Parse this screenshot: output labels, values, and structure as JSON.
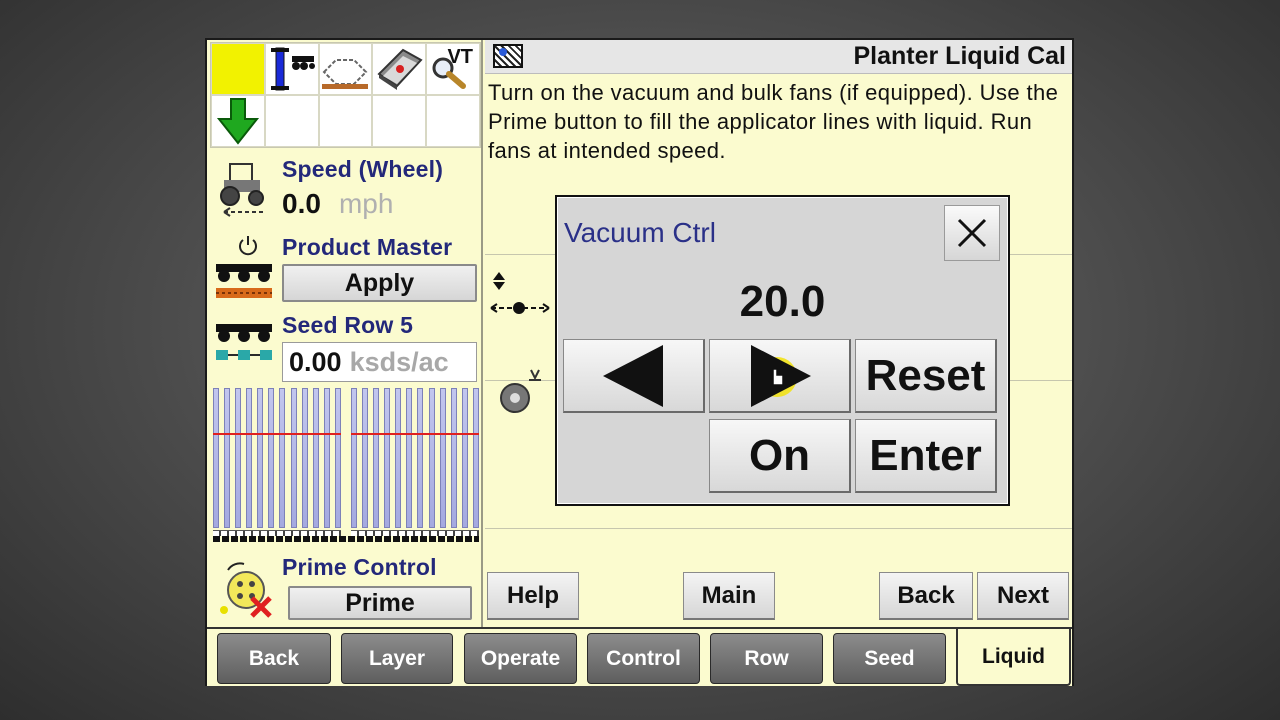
{
  "title_bar": {
    "title": "Planter Liquid Cal"
  },
  "instructions": "Turn on the vacuum and bulk fans (if equipped). Use the Prime button to fill the applicator lines with liquid. Run fans at intended speed.",
  "icon_grid": {
    "vt_label": "VT"
  },
  "speed": {
    "label": "Speed (Wheel)",
    "value": "0.0",
    "unit": "mph"
  },
  "product_master": {
    "label": "Product Master",
    "button": "Apply"
  },
  "seed_row": {
    "label": "Seed Row 5",
    "value": "0.00",
    "unit": "ksds/ac"
  },
  "prime_control": {
    "label": "Prime Control",
    "button": "Prime"
  },
  "dialog": {
    "title": "Vacuum Ctrl",
    "value": "20.0",
    "reset_label": "Reset",
    "on_label": "On",
    "enter_label": "Enter"
  },
  "footer": {
    "help": "Help",
    "main": "Main",
    "back": "Back",
    "next": "Next"
  },
  "tabs": [
    "Back",
    "Layer",
    "Operate",
    "Control",
    "Row",
    "Seed",
    "Liquid"
  ],
  "active_tab": "Liquid",
  "colors": {
    "accent_blue": "#23287a",
    "screen_bg": "#fbfbcf",
    "row_fill": "#a4a9e0",
    "target_line": "#e02020"
  }
}
